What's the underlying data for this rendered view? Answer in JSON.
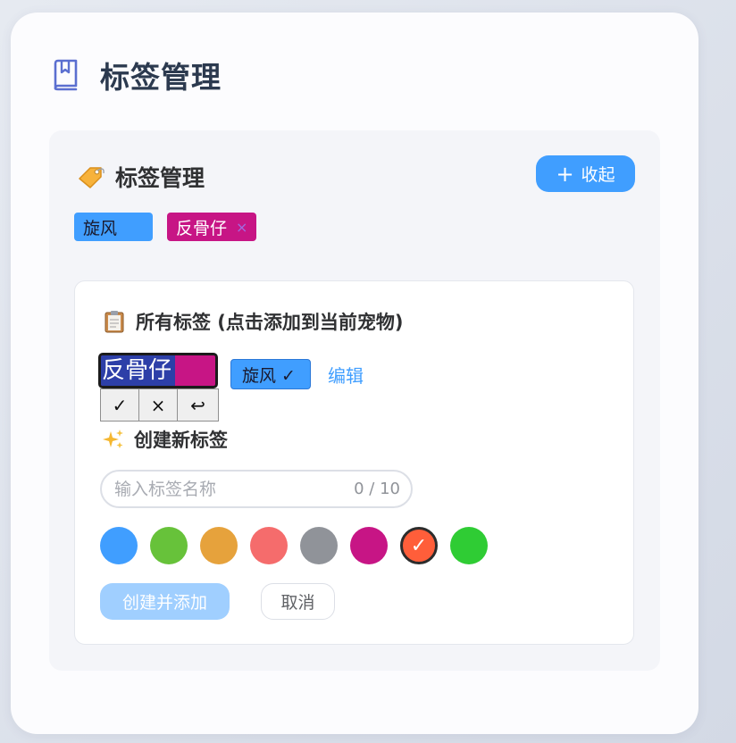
{
  "page": {
    "title": "标签管理",
    "icon": "book-icon"
  },
  "panel": {
    "title": "标签管理",
    "icon": "tag-icon",
    "collapse_label": "收起",
    "collapse_icon": "plus-icon"
  },
  "current_tags": [
    {
      "label": "旋风",
      "color": "#409eff",
      "removable": false
    },
    {
      "label": "反骨仔",
      "color": "#c71585",
      "removable": true,
      "close_icon": "close-icon",
      "close_glyph": "×"
    }
  ],
  "all_tags": {
    "title": "所有标签 (点击添加到当前宠物)",
    "icon": "clipboard-icon",
    "editing": {
      "value": "反骨仔",
      "color": "#c71585"
    },
    "edit_actions": [
      {
        "name": "confirm",
        "glyph": "✓",
        "icon": "check-icon"
      },
      {
        "name": "delete",
        "glyph": "×",
        "icon": "close-icon"
      },
      {
        "name": "cancel",
        "glyph": "↩",
        "icon": "return-icon"
      }
    ],
    "tags": [
      {
        "label": "旋风 ✓",
        "color": "#409eff",
        "added": true
      }
    ],
    "edit_link": "编辑"
  },
  "create_new": {
    "title": "创建新标签",
    "icon": "sparkles-icon",
    "input": {
      "value": "",
      "placeholder": "输入标签名称",
      "counter": "0 / 10"
    },
    "colors": [
      "#409eff",
      "#67c23a",
      "#e6a23c",
      "#f56c6c",
      "#909399",
      "#c71585",
      "#ff5e3a",
      "#2fcc34"
    ],
    "selected_color": "#ff5e3a",
    "selected_glyph": "✓",
    "create_label": "创建并添加",
    "cancel_label": "取消"
  }
}
